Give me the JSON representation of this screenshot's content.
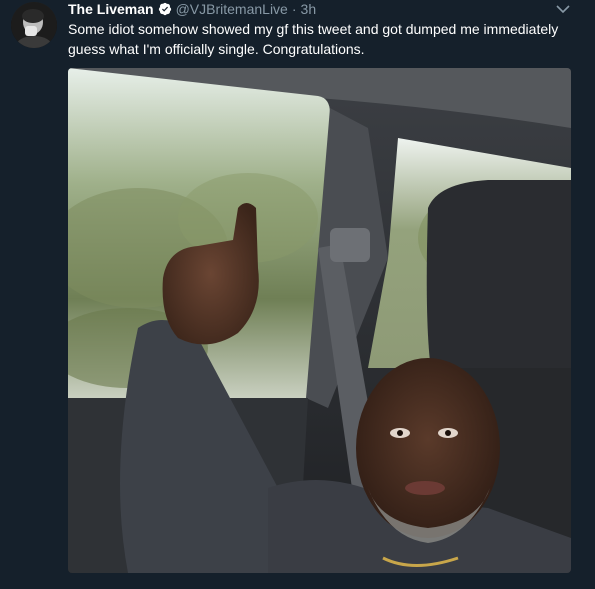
{
  "tweet": {
    "display_name": "The Liveman",
    "handle": "@VJBritemanLive",
    "separator": "·",
    "timestamp": "3h",
    "text": "Some idiot somehow showed my gf this tweet and got dumped me immediately guess what I'm officially single. Congratulations."
  },
  "icons": {
    "verified": "verified-badge-icon",
    "caret": "chevron-down-icon"
  },
  "colors": {
    "background": "#15202b",
    "text": "#ffffff",
    "muted": "#8899a6"
  }
}
